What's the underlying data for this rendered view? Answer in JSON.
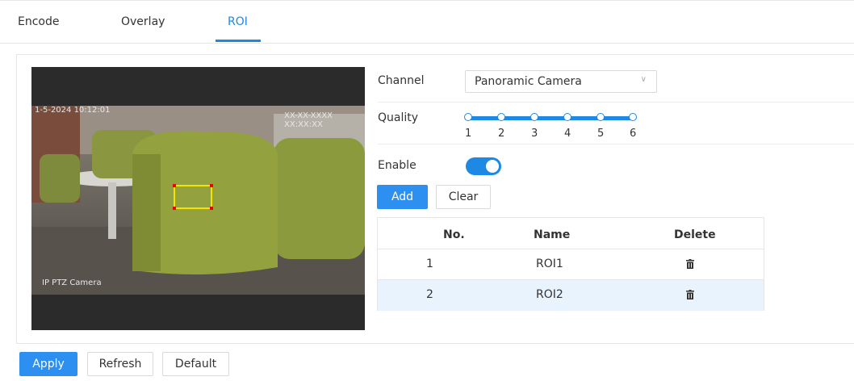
{
  "tabs": [
    {
      "label": "Encode"
    },
    {
      "label": "Overlay"
    },
    {
      "label": "ROI",
      "active": true
    }
  ],
  "video": {
    "osd_top_left": "1-5-2024 10:12:01",
    "osd_top_right": "XX-XX-XXXX XX:XX:XX",
    "osd_bottom_left": "IP PTZ Camera"
  },
  "form": {
    "channel_label": "Channel",
    "channel_value": "Panoramic Camera",
    "quality_label": "Quality",
    "quality_ticks": [
      "1",
      "2",
      "3",
      "4",
      "5",
      "6"
    ],
    "quality_value": 6,
    "enable_label": "Enable",
    "enable_on": true
  },
  "actions": {
    "add": "Add",
    "clear": "Clear"
  },
  "table": {
    "headers": [
      "No.",
      "Name",
      "Delete"
    ],
    "rows": [
      {
        "no": "1",
        "name": "ROI1"
      },
      {
        "no": "2",
        "name": "ROI2"
      }
    ]
  },
  "footer": {
    "apply": "Apply",
    "refresh": "Refresh",
    "default": "Default"
  },
  "colors": {
    "accent": "#1e88e5",
    "roi_box": "#f4e400",
    "selected_row": "#e8f3fd"
  }
}
